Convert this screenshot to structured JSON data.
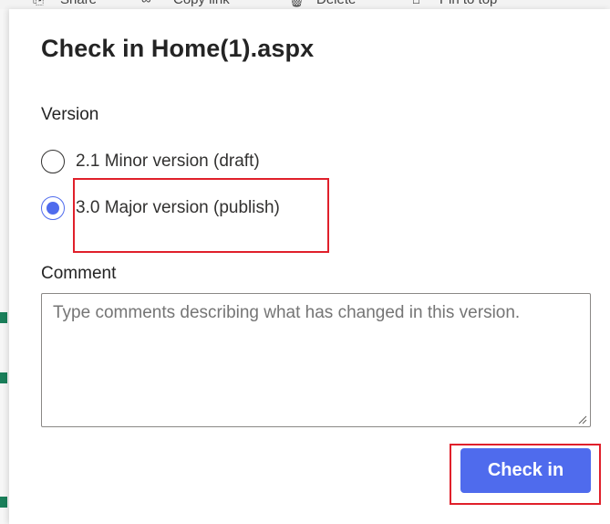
{
  "background": {
    "toolbar_items": [
      "Share",
      "Copy link",
      "Delete",
      "Pin to top"
    ]
  },
  "dialog": {
    "title": "Check in Home(1).aspx",
    "version_label": "Version",
    "options": [
      {
        "label": "2.1 Minor version (draft)",
        "checked": false
      },
      {
        "label": "3.0 Major version (publish)",
        "checked": true
      }
    ],
    "comment_label": "Comment",
    "comment_placeholder": "Type comments describing what has changed in this version.",
    "comment_value": "",
    "submit_label": "Check in"
  },
  "colors": {
    "accent": "#4f6bed",
    "highlight": "#e0202b"
  }
}
